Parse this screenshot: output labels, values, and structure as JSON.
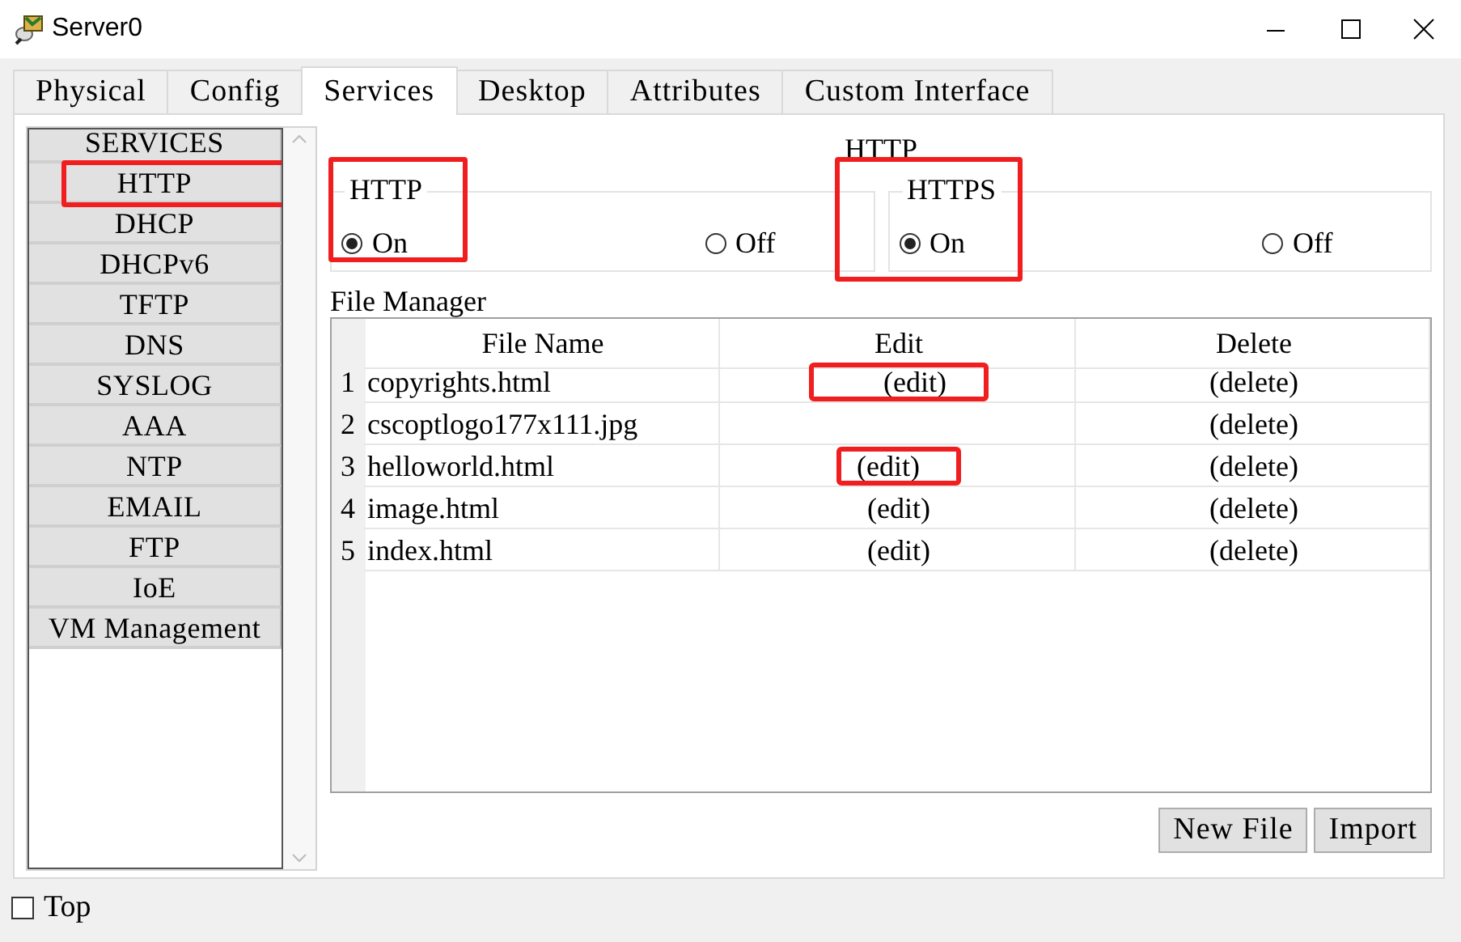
{
  "window": {
    "title": "Server0"
  },
  "tabs": [
    {
      "label": "Physical",
      "selected": false
    },
    {
      "label": "Config",
      "selected": false
    },
    {
      "label": "Services",
      "selected": true
    },
    {
      "label": "Desktop",
      "selected": false
    },
    {
      "label": "Attributes",
      "selected": false
    },
    {
      "label": "Custom Interface",
      "selected": false
    }
  ],
  "sidebar": {
    "items": [
      {
        "label": "SERVICES",
        "highlighted": false
      },
      {
        "label": "HTTP",
        "highlighted": true
      },
      {
        "label": "DHCP",
        "highlighted": false
      },
      {
        "label": "DHCPv6",
        "highlighted": false
      },
      {
        "label": "TFTP",
        "highlighted": false
      },
      {
        "label": "DNS",
        "highlighted": false
      },
      {
        "label": "SYSLOG",
        "highlighted": false
      },
      {
        "label": "AAA",
        "highlighted": false
      },
      {
        "label": "NTP",
        "highlighted": false
      },
      {
        "label": "EMAIL",
        "highlighted": false
      },
      {
        "label": "FTP",
        "highlighted": false
      },
      {
        "label": "IoE",
        "highlighted": false
      },
      {
        "label": "VM Management",
        "highlighted": false
      }
    ]
  },
  "heading": "HTTP",
  "groups": [
    {
      "title": "HTTP",
      "highlighted": true,
      "options": [
        {
          "label": "On",
          "selected": true
        },
        {
          "label": "Off",
          "selected": false
        }
      ]
    },
    {
      "title": "HTTPS",
      "highlighted": true,
      "options": [
        {
          "label": "On",
          "selected": true
        },
        {
          "label": "Off",
          "selected": false
        }
      ]
    }
  ],
  "file_manager": {
    "title": "File Manager",
    "columns": [
      "File Name",
      "Edit",
      "Delete"
    ],
    "rows": [
      {
        "number": "1",
        "file_name": "copyrights.html",
        "edit": "(edit)",
        "edit_highlighted": true,
        "delete": "(delete)"
      },
      {
        "number": "2",
        "file_name": "cscoptlogo177x111.jpg",
        "delete": "(delete)"
      },
      {
        "number": "3",
        "file_name": "helloworld.html",
        "edit": "(edit)",
        "edit_highlighted": true,
        "delete": "(delete)"
      },
      {
        "number": "4",
        "file_name": "image.html",
        "edit": "(edit)",
        "edit_highlighted": false,
        "delete": "(delete)"
      },
      {
        "number": "5",
        "file_name": "index.html",
        "edit": "(edit)",
        "edit_highlighted": false,
        "delete": "(delete)"
      }
    ],
    "buttons": [
      "New File",
      "Import"
    ]
  },
  "top_checkbox": {
    "label": "Top",
    "checked": false
  }
}
